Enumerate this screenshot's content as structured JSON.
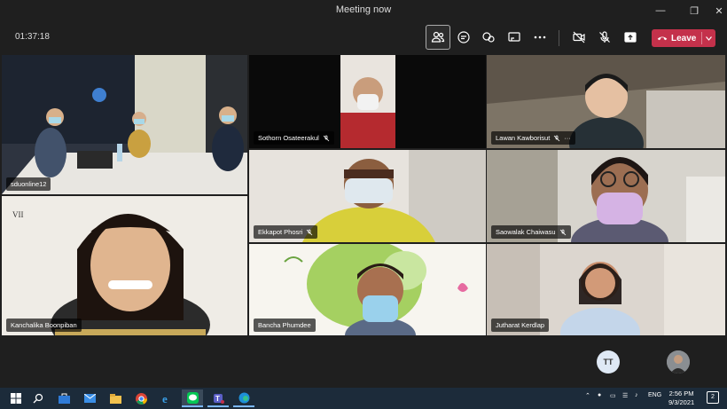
{
  "window": {
    "title": "Meeting now"
  },
  "meeting": {
    "timer": "01:37:18",
    "leave_label": "Leave"
  },
  "toolbar": {
    "icons": [
      "people-icon",
      "chat-icon",
      "reactions-icon",
      "share-tray-icon",
      "more-icon",
      "camera-off-icon",
      "mic-off-icon",
      "share-screen-icon"
    ]
  },
  "participants": [
    {
      "name": "sduonline12",
      "muted": false
    },
    {
      "name": "Sothorn Osateerakul",
      "muted": true
    },
    {
      "name": "Lawan Kawborisut",
      "muted": true,
      "more": "···"
    },
    {
      "name": "Ekkapot Phosri",
      "muted": true
    },
    {
      "name": "Saowalak Chaiwasu",
      "muted": true
    },
    {
      "name": "Kanchalika Boonpiban",
      "muted": false
    },
    {
      "name": "Bancha Phumdee",
      "muted": false
    },
    {
      "name": "Jutharat Kerdlap",
      "muted": false
    }
  ],
  "lower": {
    "initials": "TT"
  },
  "taskbar": {
    "time": "2:56 PM",
    "date": "9/3/2021",
    "language": "ENG",
    "notification_count": "2"
  },
  "colors": {
    "leave": "#c4314b",
    "taskbar": "#1c2b3a",
    "background": "#1f1f1f"
  }
}
